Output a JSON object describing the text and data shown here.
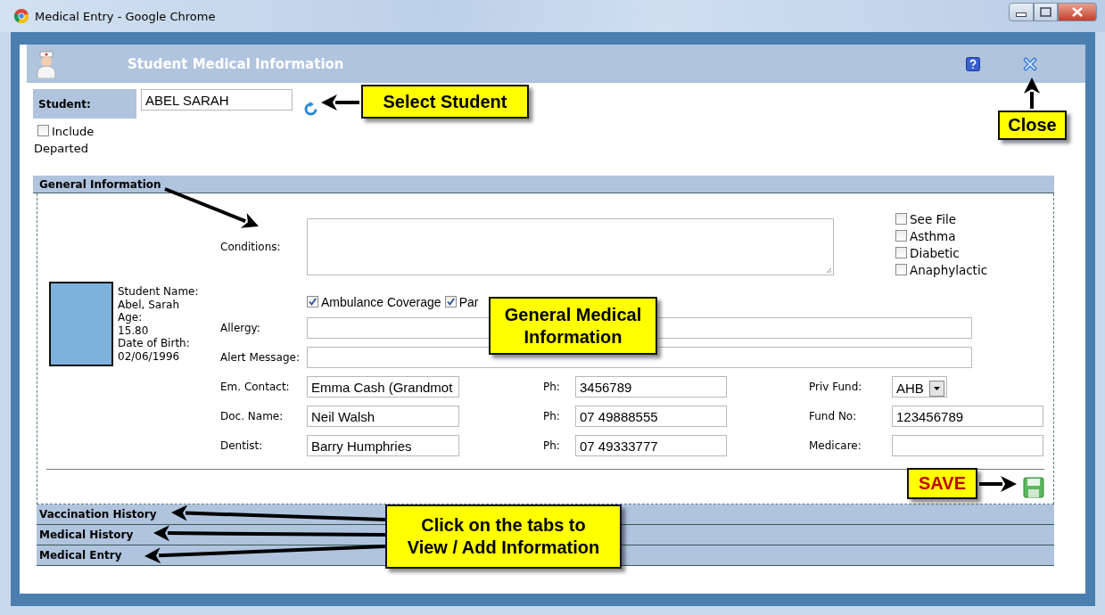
{
  "window": {
    "title": "Medical Entry - Google Chrome"
  },
  "header": {
    "title": "Student Medical Information"
  },
  "student": {
    "label": "Student:",
    "value": "ABEL SARAH",
    "include_departed": {
      "label": "Include Departed",
      "checked": false
    }
  },
  "profile": [
    {
      "label": "Student Name:",
      "value": "Abel, Sarah"
    },
    {
      "label": "Age:",
      "value": "15.80"
    },
    {
      "label": "Date of Birth:",
      "value": "02/06/1996"
    }
  ],
  "conditions": {
    "label": "Conditions:"
  },
  "flags": [
    {
      "label": "See File",
      "checked": false
    },
    {
      "label": "Asthma",
      "checked": false
    },
    {
      "label": "Diabetic",
      "checked": false
    },
    {
      "label": "Anaphylactic",
      "checked": false
    }
  ],
  "coverage": [
    {
      "label": "Ambulance Coverage",
      "checked": true
    },
    {
      "label": "Par",
      "checked": true
    }
  ],
  "allergy": {
    "label": "Allergy:"
  },
  "alert_message": {
    "label": "Alert Message:"
  },
  "contacts": [
    {
      "label": "Em. Contact:",
      "value": "Emma Cash (Grandmot",
      "phone_label": "Ph:",
      "phone": "3456789",
      "extra": {
        "kind": "dropdown",
        "label": "Priv Fund:",
        "value": "AHB"
      }
    },
    {
      "label": "Doc. Name:",
      "value": "Neil Walsh",
      "phone_label": "Ph:",
      "phone": "07 49888555",
      "extra": {
        "kind": "text",
        "label": "Fund No:",
        "value": "123456789"
      }
    },
    {
      "label": "Dentist:",
      "value": "Barry Humphries",
      "phone_label": "Ph:",
      "phone": "07 49333777",
      "extra": {
        "kind": "text",
        "label": "Medicare:"
      }
    }
  ],
  "sections": [
    {
      "title": "General Information",
      "expanded": true
    },
    {
      "title": "Vaccination History",
      "expanded": false
    },
    {
      "title": "Medical History",
      "expanded": false
    },
    {
      "title": "Medical Entry",
      "expanded": false
    }
  ],
  "callouts": [
    {
      "text": "Select Student"
    },
    {
      "text": "Close"
    },
    {
      "text": "General Medical\nInformation"
    },
    {
      "text": "SAVE"
    },
    {
      "text": "Click on the tabs to\nView / Add Information"
    }
  ]
}
